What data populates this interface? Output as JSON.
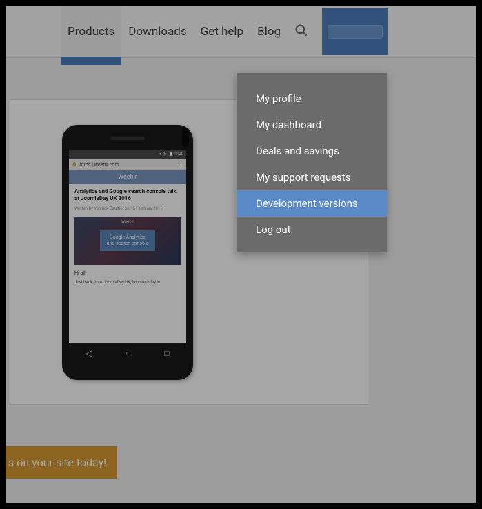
{
  "nav": {
    "items": [
      {
        "label": "Products",
        "active": true
      },
      {
        "label": "Downloads",
        "active": false
      },
      {
        "label": "Get help",
        "active": false
      },
      {
        "label": "Blog",
        "active": false
      }
    ]
  },
  "dropdown": {
    "items": [
      {
        "label": "My profile"
      },
      {
        "label": "My dashboard"
      },
      {
        "label": "Deals and savings"
      },
      {
        "label": "My support requests"
      },
      {
        "label": "Development versions",
        "highlighted": true
      },
      {
        "label": "Log out"
      }
    ]
  },
  "phone": {
    "status_time": "19:00",
    "status_icons": "▾ ◎ ▪ ▮",
    "url": "https | weeblr.com",
    "banner": "Weeblr",
    "article_title": "Analytics and Google search console talk at JoomlaDay UK 2016",
    "article_meta": "Written by Yannick Gaultier on 15 February 2016.",
    "hero_logo": "Weeblr",
    "hero_box_line1": "Google Analytics",
    "hero_box_line2": "and search console",
    "greeting": "Hi all,",
    "body_snippet": "Just back from JoomlaDay UK, last saturday in"
  },
  "cta": {
    "label": "s on your site today!"
  }
}
